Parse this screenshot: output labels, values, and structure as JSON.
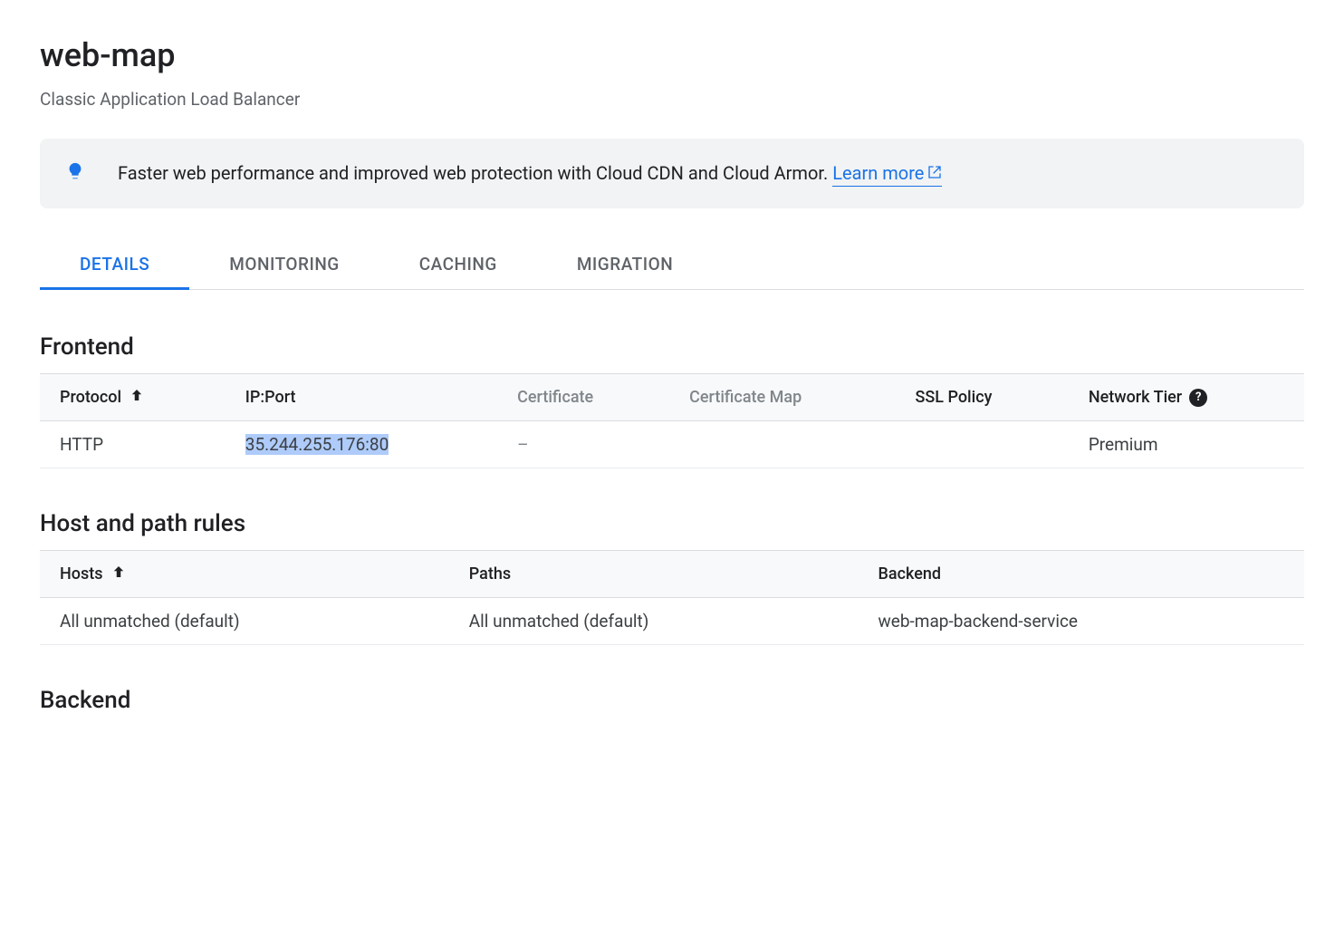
{
  "title": "web-map",
  "subtitle": "Classic Application Load Balancer",
  "banner": {
    "text": "Faster web performance and improved web protection with Cloud CDN and Cloud Armor. ",
    "link_label": "Learn more"
  },
  "tabs": [
    {
      "label": "DETAILS",
      "active": true
    },
    {
      "label": "MONITORING",
      "active": false
    },
    {
      "label": "CACHING",
      "active": false
    },
    {
      "label": "MIGRATION",
      "active": false
    }
  ],
  "sections": {
    "frontend": {
      "heading": "Frontend",
      "columns": {
        "protocol": "Protocol",
        "ip_port": "IP:Port",
        "certificate": "Certificate",
        "certificate_map": "Certificate Map",
        "ssl_policy": "SSL Policy",
        "network_tier": "Network Tier"
      },
      "rows": [
        {
          "protocol": "HTTP",
          "ip_port": "35.244.255.176:80",
          "certificate": "–",
          "certificate_map": "",
          "ssl_policy": "",
          "network_tier": "Premium"
        }
      ]
    },
    "host_path": {
      "heading": "Host and path rules",
      "columns": {
        "hosts": "Hosts",
        "paths": "Paths",
        "backend": "Backend"
      },
      "rows": [
        {
          "hosts": "All unmatched (default)",
          "paths": "All unmatched (default)",
          "backend": "web-map-backend-service"
        }
      ]
    },
    "backend": {
      "heading": "Backend"
    }
  }
}
